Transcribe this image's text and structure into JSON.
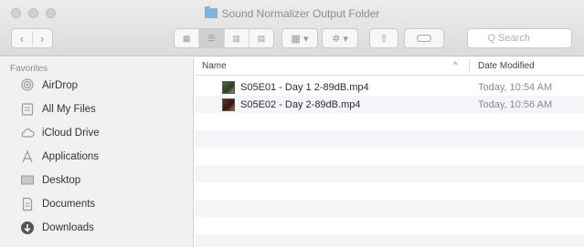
{
  "window": {
    "title": "Sound Normalizer Output Folder"
  },
  "toolbar": {
    "back_symbol": "‹",
    "forward_symbol": "›",
    "views": [
      "▦",
      "☰",
      "▥",
      "▤"
    ],
    "arrange_symbol": "▦ ▾",
    "action_symbol": "✲ ▾",
    "share_symbol": "⇧",
    "search_placeholder": "Q Search"
  },
  "sidebar": {
    "header": "Favorites",
    "items": [
      {
        "label": "AirDrop",
        "icon": "airdrop-icon"
      },
      {
        "label": "All My Files",
        "icon": "all-files-icon"
      },
      {
        "label": "iCloud Drive",
        "icon": "cloud-icon"
      },
      {
        "label": "Applications",
        "icon": "applications-icon"
      },
      {
        "label": "Desktop",
        "icon": "desktop-icon"
      },
      {
        "label": "Documents",
        "icon": "documents-icon"
      },
      {
        "label": "Downloads",
        "icon": "downloads-icon"
      }
    ]
  },
  "columns": {
    "name": "Name",
    "sort_indicator": "^",
    "date": "Date Modified"
  },
  "files": [
    {
      "name": "S05E01 - Day 1 2-89dB.mp4",
      "date": "Today, 10:54 AM"
    },
    {
      "name": "S05E02 - Day 2-89dB.mp4",
      "date": "Today, 10:56 AM"
    }
  ],
  "colors": {
    "folder": "#7fb3de",
    "sidebar_bg": "#f1f1f1",
    "row_alt": "#f3f5f8"
  }
}
